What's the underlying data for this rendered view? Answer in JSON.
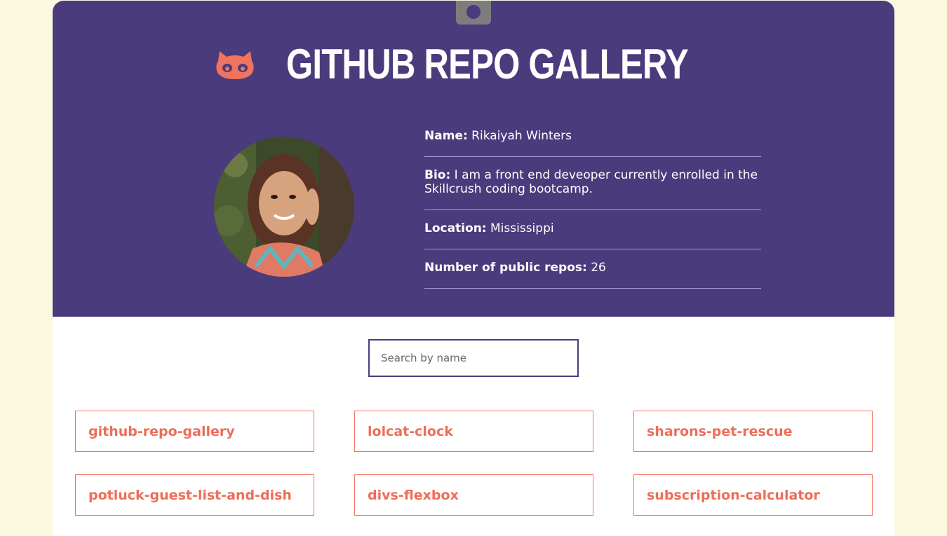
{
  "header": {
    "title": "GITHUB REPO GALLERY",
    "logo_icon": "octocat-icon",
    "accent_color": "#f0735f",
    "background_color": "#4a3b7c"
  },
  "profile": {
    "avatar_alt": "profile photo",
    "name_label": "Name:",
    "name_value": "Rikaiyah Winters",
    "bio_label": "Bio:",
    "bio_value": "I am a front end deveoper currently enrolled in the Skillcrush coding bootcamp.",
    "location_label": "Location:",
    "location_value": "Mississippi",
    "repos_label": "Number of public repos:",
    "repos_value": "26"
  },
  "search": {
    "placeholder": "Search by name",
    "value": ""
  },
  "repos": [
    "github-repo-gallery",
    "lolcat-clock",
    "sharons-pet-rescue",
    "potluck-guest-list-and-dish",
    "divs-flexbox",
    "subscription-calculator"
  ]
}
